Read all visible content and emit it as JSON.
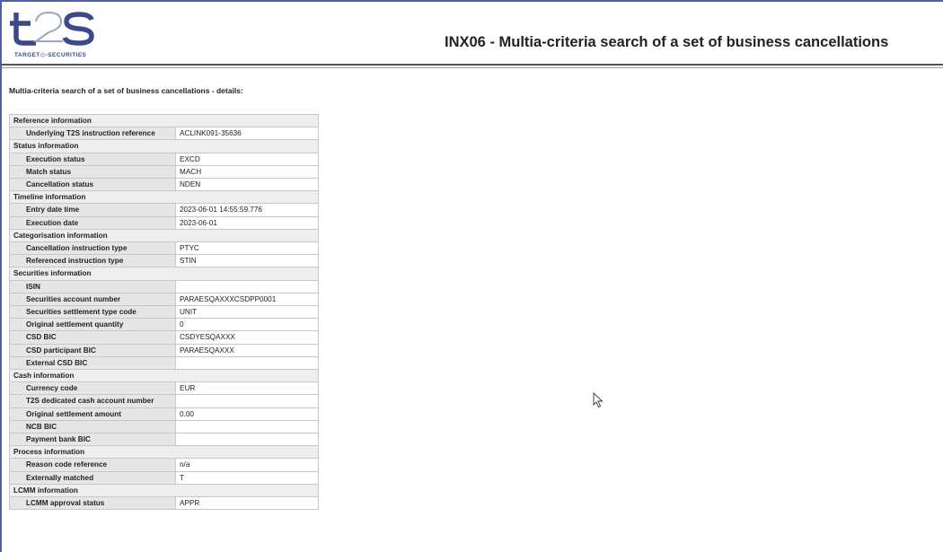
{
  "header": {
    "logo_text": "t2s",
    "logo_subtext_left": "TARGET",
    "logo_subtext_right": "-SECURITIES",
    "title": "INX06 - Multia-criteria search of a set of business cancellations"
  },
  "subtitle": "Multia-criteria search of a set of business cancellations - details:",
  "sections": [
    {
      "title": "Reference information",
      "rows": [
        {
          "label": "Underlying T2S instruction reference",
          "value": "ACLINK091-35636"
        }
      ]
    },
    {
      "title": "Status information",
      "rows": [
        {
          "label": "Execution status",
          "value": "EXCD"
        },
        {
          "label": "Match status",
          "value": "MACH"
        },
        {
          "label": "Cancellation status",
          "value": "NDEN"
        }
      ]
    },
    {
      "title": "Timeline information",
      "rows": [
        {
          "label": "Entry date time",
          "value": "2023-06-01 14:55:59.776"
        },
        {
          "label": "Execution date",
          "value": "2023-06-01"
        }
      ]
    },
    {
      "title": "Categorisation information",
      "rows": [
        {
          "label": "Cancellation instruction type",
          "value": "PTYC"
        },
        {
          "label": "Referenced instruction type",
          "value": "STIN"
        }
      ]
    },
    {
      "title": "Securities information",
      "rows": [
        {
          "label": "ISIN",
          "value": ""
        },
        {
          "label": "Securities account number",
          "value": "PARAESQAXXXCSDPP0001"
        },
        {
          "label": "Securities settlement type code",
          "value": "UNIT"
        },
        {
          "label": "Original settlement quantity",
          "value": "0"
        },
        {
          "label": "CSD BIC",
          "value": "CSDYESQAXXX"
        },
        {
          "label": "CSD participant BIC",
          "value": "PARAESQAXXX"
        },
        {
          "label": "External CSD BIC",
          "value": ""
        }
      ]
    },
    {
      "title": "Cash information",
      "rows": [
        {
          "label": "Currency code",
          "value": "EUR"
        },
        {
          "label": "T2S dedicated cash account number",
          "value": ""
        },
        {
          "label": "Original settlement amount",
          "value": "0.00"
        },
        {
          "label": "NCB BIC",
          "value": ""
        },
        {
          "label": "Payment bank BIC",
          "value": ""
        }
      ]
    },
    {
      "title": "Process information",
      "rows": [
        {
          "label": "Reason code reference",
          "value": "n/a"
        },
        {
          "label": "Externally matched",
          "value": "T"
        }
      ]
    },
    {
      "title": "LCMM information",
      "rows": [
        {
          "label": "LCMM approval status",
          "value": "APPR"
        }
      ]
    }
  ],
  "colors": {
    "frame": "#4a63a6",
    "logo": "#3b4a8c",
    "section_bg": "#eeeeee",
    "label_bg": "#e6e6e6"
  }
}
